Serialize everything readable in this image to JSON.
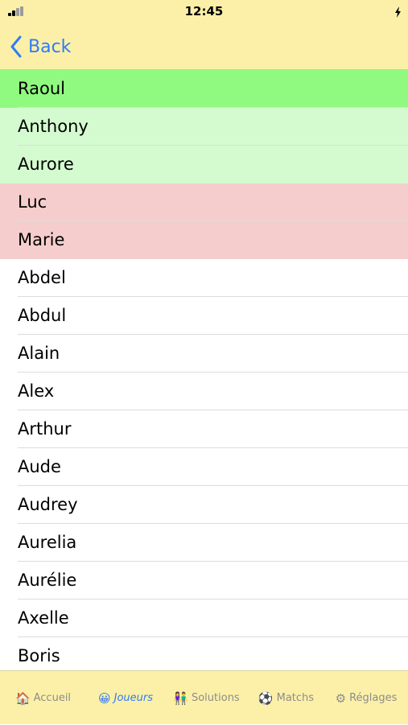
{
  "status_bar": {
    "time": "12:45"
  },
  "nav": {
    "back_label": "Back"
  },
  "players": [
    {
      "name": "Raoul",
      "highlight": "#90f980"
    },
    {
      "name": "Anthony",
      "highlight": "#d4fbcf"
    },
    {
      "name": "Aurore",
      "highlight": "#d4fbcf"
    },
    {
      "name": "Luc",
      "highlight": "#f6cdcd"
    },
    {
      "name": "Marie",
      "highlight": "#f6cdcd"
    },
    {
      "name": "Abdel",
      "highlight": "#ffffff"
    },
    {
      "name": "Abdul",
      "highlight": "#ffffff"
    },
    {
      "name": "Alain",
      "highlight": "#ffffff"
    },
    {
      "name": "Alex",
      "highlight": "#ffffff"
    },
    {
      "name": "Arthur",
      "highlight": "#ffffff"
    },
    {
      "name": "Aude",
      "highlight": "#ffffff"
    },
    {
      "name": "Audrey",
      "highlight": "#ffffff"
    },
    {
      "name": "Aurelia",
      "highlight": "#ffffff"
    },
    {
      "name": "Aurélie",
      "highlight": "#ffffff"
    },
    {
      "name": "Axelle",
      "highlight": "#ffffff"
    },
    {
      "name": "Boris",
      "highlight": "#ffffff"
    }
  ],
  "tabs": [
    {
      "label": "Accueil",
      "icon": "house-icon",
      "glyph": "🏠",
      "active": false
    },
    {
      "label": "Joueurs",
      "icon": "smiley-icon",
      "glyph": "😀",
      "active": true
    },
    {
      "label": "Solutions",
      "icon": "people-icon",
      "glyph": "👫",
      "active": false
    },
    {
      "label": "Matchs",
      "icon": "ball-icon",
      "glyph": "⚽",
      "active": false
    },
    {
      "label": "Réglages",
      "icon": "gear-icon",
      "glyph": "⚙",
      "active": false
    }
  ],
  "colors": {
    "header_bg": "#fcf0a8",
    "accent": "#2f7cf6",
    "selected_green": "#90f980",
    "light_green": "#d4fbcf",
    "light_red": "#f6cdcd"
  }
}
